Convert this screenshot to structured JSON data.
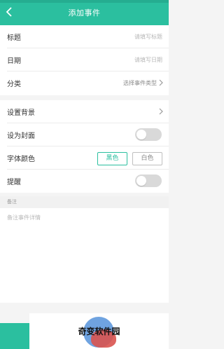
{
  "header": {
    "title": "添加事件",
    "back_icon": "chevron-left-icon",
    "color": "#2bbf9f"
  },
  "form": {
    "title_label": "标题",
    "title_placeholder": "请填写标题",
    "date_label": "日期",
    "date_placeholder": "请填写日期",
    "category_label": "分类",
    "category_value": "选择事件类型"
  },
  "settings": {
    "background_label": "设置背景",
    "cover_label": "设为封面",
    "cover_on": false,
    "font_color_label": "字体颜色",
    "font_color_black": "黑色",
    "font_color_white": "白色",
    "font_color_selected": "黑色",
    "reminder_label": "提醒",
    "reminder_on": false
  },
  "note": {
    "header": "备注",
    "placeholder": "备注事件详情"
  },
  "watermark": {
    "text": "奇变软件园"
  }
}
